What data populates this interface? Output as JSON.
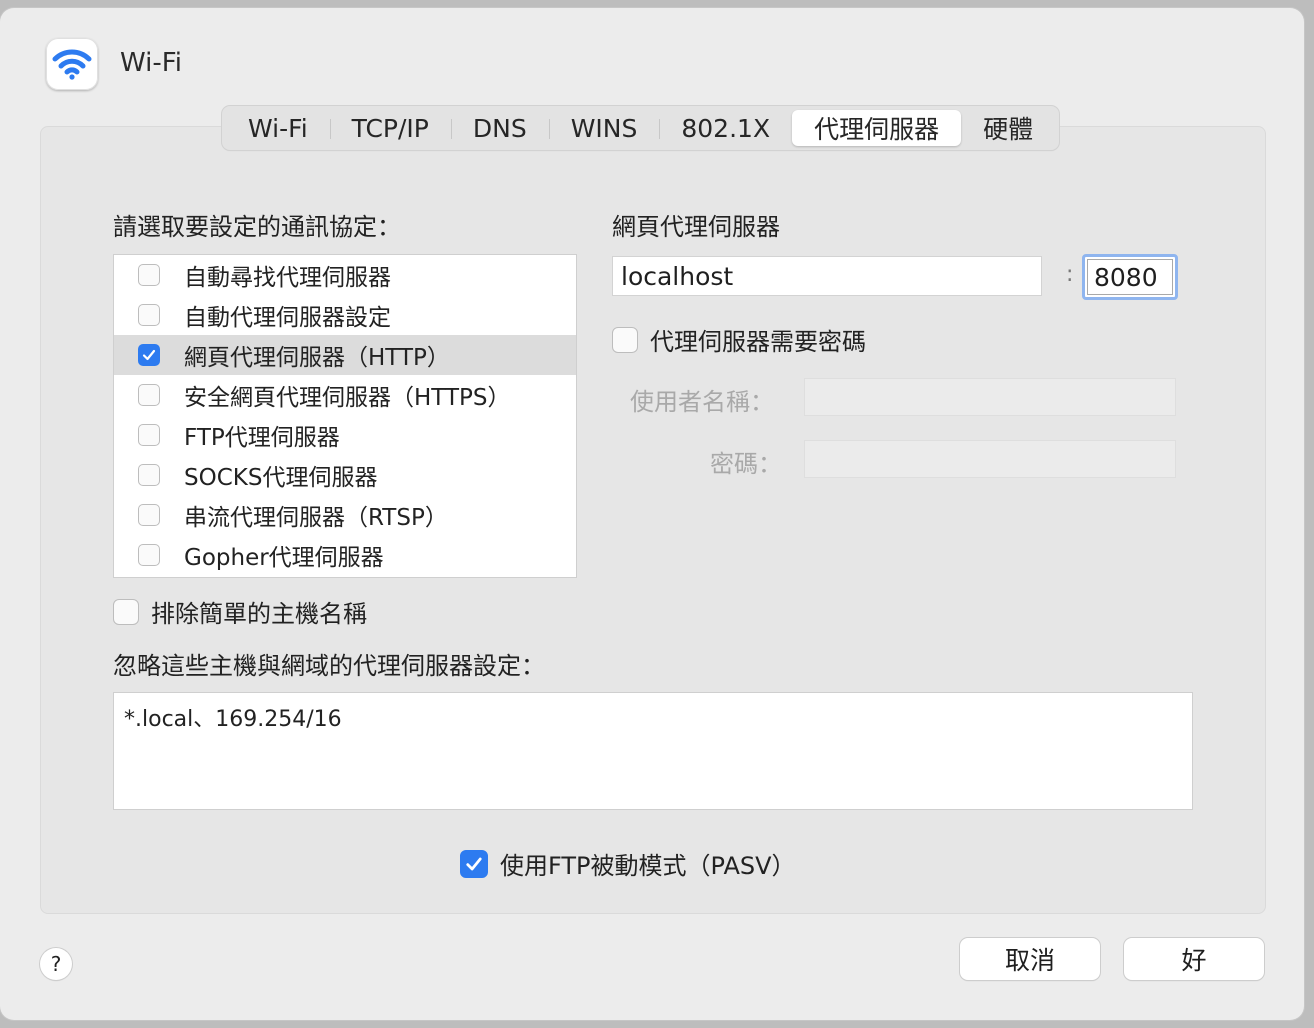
{
  "window": {
    "title": "Wi-Fi",
    "icon": "wifi-icon"
  },
  "tabs": [
    {
      "label": "Wi-Fi",
      "active": false
    },
    {
      "label": "TCP/IP",
      "active": false
    },
    {
      "label": "DNS",
      "active": false
    },
    {
      "label": "WINS",
      "active": false
    },
    {
      "label": "802.1X",
      "active": false
    },
    {
      "label": "代理伺服器",
      "active": true
    },
    {
      "label": "硬體",
      "active": false
    }
  ],
  "protocols": {
    "heading": "請選取要設定的通訊協定：",
    "items": [
      {
        "label": "自動尋找代理伺服器",
        "checked": false,
        "selected": false
      },
      {
        "label": "自動代理伺服器設定",
        "checked": false,
        "selected": false
      },
      {
        "label": "網頁代理伺服器（HTTP）",
        "checked": true,
        "selected": true
      },
      {
        "label": "安全網頁代理伺服器（HTTPS）",
        "checked": false,
        "selected": false
      },
      {
        "label": "FTP代理伺服器",
        "checked": false,
        "selected": false
      },
      {
        "label": "SOCKS代理伺服器",
        "checked": false,
        "selected": false
      },
      {
        "label": "串流代理伺服器（RTSP）",
        "checked": false,
        "selected": false
      },
      {
        "label": "Gopher代理伺服器",
        "checked": false,
        "selected": false
      }
    ]
  },
  "proxy_config": {
    "heading": "網頁代理伺服器",
    "server_value": "localhost",
    "port_separator": ":",
    "port_value": "8080",
    "requires_password_label": "代理伺服器需要密碼",
    "requires_password_checked": false,
    "username_label": "使用者名稱：",
    "password_label": "密碼："
  },
  "exclude_simple": {
    "label": "排除簡單的主機名稱",
    "checked": false
  },
  "bypass": {
    "label": "忽略這些主機與網域的代理伺服器設定：",
    "value": "*.local、169.254/16"
  },
  "pasv": {
    "label": "使用FTP被動模式（PASV）",
    "checked": true
  },
  "footer": {
    "help_label": "?",
    "cancel_label": "取消",
    "ok_label": "好"
  },
  "colors": {
    "accent": "#2d7bf0",
    "focus_ring": "#8fb5ef"
  }
}
